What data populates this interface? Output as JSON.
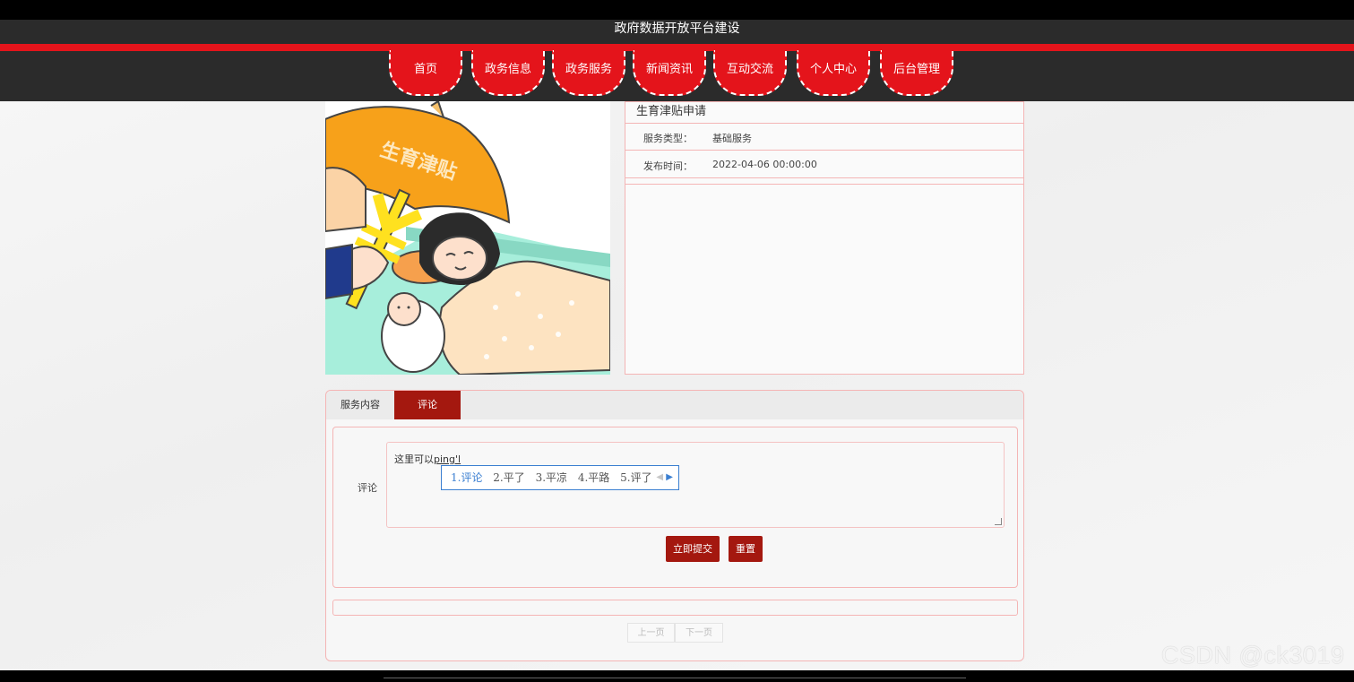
{
  "header": {
    "site_title": "政府数据开放平台建设"
  },
  "nav": {
    "items": [
      "首页",
      "政务信息",
      "政务服务",
      "新闻资讯",
      "互动交流",
      "个人中心",
      "后台管理"
    ]
  },
  "service": {
    "title": "生育津贴申请",
    "type_label": "服务类型：",
    "type_value": "基础服务",
    "time_label": "发布时间：",
    "time_value": "2022-04-06 00:00:00",
    "image_caption": "生育津贴"
  },
  "tabs": {
    "content": "服务内容",
    "comment": "评论"
  },
  "form": {
    "label": "评论",
    "typed_text": "这里可以",
    "composing_text": "ping'l"
  },
  "ime": {
    "candidates": [
      "1.评论",
      "2.平了",
      "3.平凉",
      "4.平路",
      "5.评了"
    ]
  },
  "buttons": {
    "submit": "立即提交",
    "reset": "重置"
  },
  "pager": {
    "prev": "上一页",
    "next": "下一页"
  },
  "watermark": "CSDN @ck3019"
}
